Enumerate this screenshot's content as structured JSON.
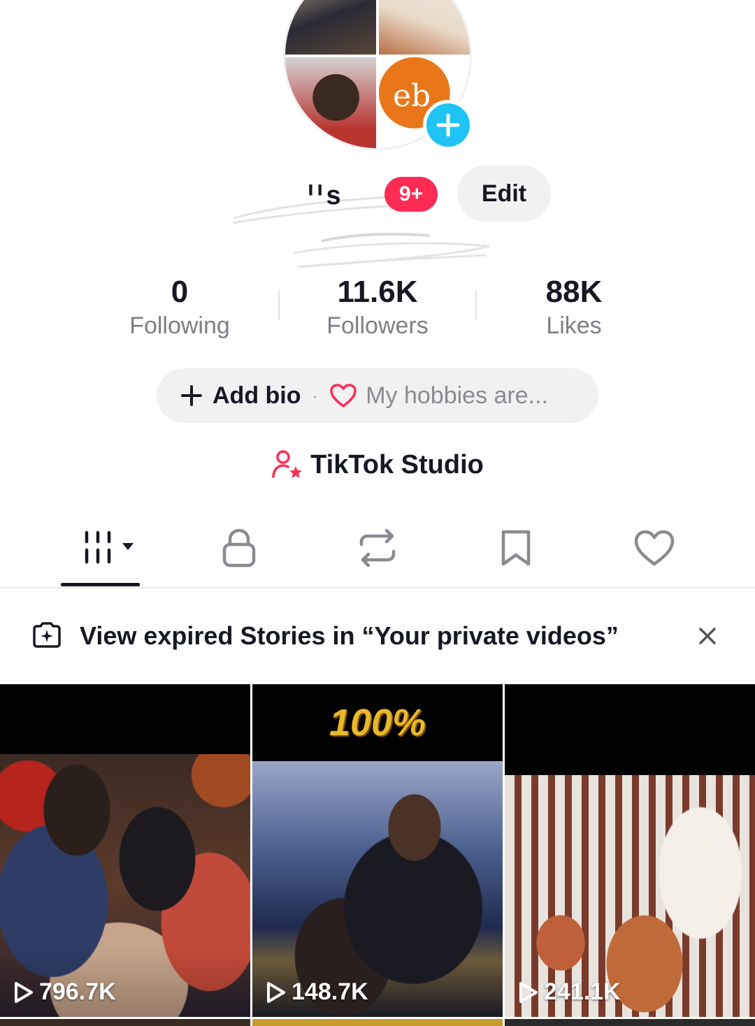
{
  "profile": {
    "username": "ᑊ ᑊ s",
    "notification_badge": "9+",
    "edit_label": "Edit",
    "avatar_text": "eb"
  },
  "stats": {
    "following": {
      "value": "0",
      "label": "Following"
    },
    "followers": {
      "value": "11.6K",
      "label": "Followers"
    },
    "likes": {
      "value": "88K",
      "label": "Likes"
    }
  },
  "bio": {
    "add_label": "Add bio",
    "separator": "·",
    "hobby_placeholder": "My hobbies are..."
  },
  "studio": {
    "label": "TikTok Studio"
  },
  "tabs": [
    {
      "icon": "grid-icon",
      "active": true
    },
    {
      "icon": "lock-icon",
      "active": false
    },
    {
      "icon": "repost-icon",
      "active": false
    },
    {
      "icon": "bookmark-icon",
      "active": false
    },
    {
      "icon": "heart-icon",
      "active": false
    }
  ],
  "story_banner": {
    "text": "View expired Stories in “Your private videos”"
  },
  "videos": [
    {
      "views": "796.7K"
    },
    {
      "views": "148.7K",
      "overlay_text": "100%"
    },
    {
      "views": "241.1K"
    }
  ],
  "colors": {
    "accent_red": "#fe2c55",
    "plus_blue": "#20c4f4",
    "text_primary": "#161823",
    "text_secondary": "#7e7f86",
    "pill_bg": "#f1f1f2"
  }
}
